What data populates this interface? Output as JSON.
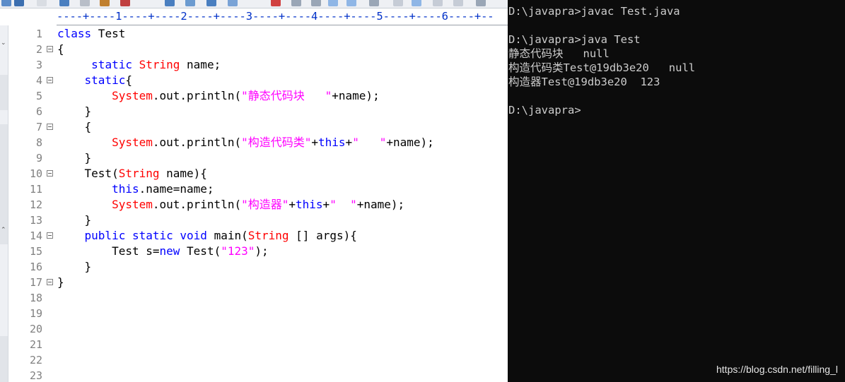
{
  "editor": {
    "ruler": "----+----1----+----2----+----3----+----4----+----5----+----6----+--",
    "lines": [
      {
        "num": "1",
        "fold": false,
        "tokens": [
          {
            "t": "class",
            "c": "kw"
          },
          {
            "t": " Test",
            "c": ""
          }
        ]
      },
      {
        "num": "2",
        "fold": true,
        "tokens": [
          {
            "t": "{",
            "c": ""
          }
        ]
      },
      {
        "num": "3",
        "fold": false,
        "tokens": [
          {
            "t": "     ",
            "c": ""
          },
          {
            "t": "static",
            "c": "kw"
          },
          {
            "t": " ",
            "c": ""
          },
          {
            "t": "String",
            "c": "type"
          },
          {
            "t": " name;",
            "c": ""
          }
        ]
      },
      {
        "num": "4",
        "fold": true,
        "tokens": [
          {
            "t": "    ",
            "c": ""
          },
          {
            "t": "static",
            "c": "kw"
          },
          {
            "t": "{",
            "c": ""
          }
        ]
      },
      {
        "num": "5",
        "fold": false,
        "tokens": [
          {
            "t": "        ",
            "c": ""
          },
          {
            "t": "System",
            "c": "type"
          },
          {
            "t": ".out.println(",
            "c": ""
          },
          {
            "t": "\"静态代码块   \"",
            "c": "str"
          },
          {
            "t": "+name);",
            "c": ""
          }
        ]
      },
      {
        "num": "6",
        "fold": false,
        "tokens": [
          {
            "t": "    }",
            "c": ""
          }
        ]
      },
      {
        "num": "7",
        "fold": true,
        "tokens": [
          {
            "t": "    {",
            "c": ""
          }
        ]
      },
      {
        "num": "8",
        "fold": false,
        "tokens": [
          {
            "t": "        ",
            "c": ""
          },
          {
            "t": "System",
            "c": "type"
          },
          {
            "t": ".out.println(",
            "c": ""
          },
          {
            "t": "\"构造代码类\"",
            "c": "str"
          },
          {
            "t": "+",
            "c": ""
          },
          {
            "t": "this",
            "c": "kw"
          },
          {
            "t": "+",
            "c": ""
          },
          {
            "t": "\"   \"",
            "c": "str"
          },
          {
            "t": "+name);",
            "c": ""
          }
        ]
      },
      {
        "num": "9",
        "fold": false,
        "tokens": [
          {
            "t": "    }",
            "c": ""
          }
        ]
      },
      {
        "num": "10",
        "fold": true,
        "tokens": [
          {
            "t": "    Test(",
            "c": ""
          },
          {
            "t": "String",
            "c": "type"
          },
          {
            "t": " name){",
            "c": ""
          }
        ]
      },
      {
        "num": "11",
        "fold": false,
        "tokens": [
          {
            "t": "        ",
            "c": ""
          },
          {
            "t": "this",
            "c": "kw"
          },
          {
            "t": ".name=name;",
            "c": ""
          }
        ]
      },
      {
        "num": "12",
        "fold": false,
        "tokens": [
          {
            "t": "        ",
            "c": ""
          },
          {
            "t": "System",
            "c": "type"
          },
          {
            "t": ".out.println(",
            "c": ""
          },
          {
            "t": "\"构造器\"",
            "c": "str"
          },
          {
            "t": "+",
            "c": ""
          },
          {
            "t": "this",
            "c": "kw"
          },
          {
            "t": "+",
            "c": ""
          },
          {
            "t": "\"  \"",
            "c": "str"
          },
          {
            "t": "+name);",
            "c": ""
          }
        ]
      },
      {
        "num": "13",
        "fold": false,
        "tokens": [
          {
            "t": "    }",
            "c": ""
          }
        ]
      },
      {
        "num": "14",
        "fold": true,
        "tokens": [
          {
            "t": "    ",
            "c": ""
          },
          {
            "t": "public",
            "c": "kw"
          },
          {
            "t": " ",
            "c": ""
          },
          {
            "t": "static",
            "c": "kw"
          },
          {
            "t": " ",
            "c": ""
          },
          {
            "t": "void",
            "c": "kw"
          },
          {
            "t": " main(",
            "c": ""
          },
          {
            "t": "String",
            "c": "type"
          },
          {
            "t": " [] args){",
            "c": ""
          }
        ]
      },
      {
        "num": "15",
        "fold": false,
        "tokens": [
          {
            "t": "        Test s=",
            "c": ""
          },
          {
            "t": "new",
            "c": "kw"
          },
          {
            "t": " Test(",
            "c": ""
          },
          {
            "t": "\"123\"",
            "c": "str"
          },
          {
            "t": ");",
            "c": ""
          }
        ]
      },
      {
        "num": "16",
        "fold": false,
        "tokens": [
          {
            "t": "    }",
            "c": ""
          }
        ]
      },
      {
        "num": "17",
        "fold": true,
        "tokens": [
          {
            "t": "}",
            "c": ""
          }
        ]
      },
      {
        "num": "18",
        "fold": false,
        "tokens": []
      },
      {
        "num": "19",
        "fold": false,
        "tokens": []
      },
      {
        "num": "20",
        "fold": false,
        "tokens": []
      },
      {
        "num": "21",
        "fold": false,
        "tokens": []
      },
      {
        "num": "22",
        "fold": false,
        "tokens": []
      },
      {
        "num": "23",
        "fold": false,
        "tokens": []
      }
    ]
  },
  "console": {
    "lines": [
      "D:\\javapra>javac Test.java",
      "",
      "D:\\javapra>java Test",
      "静态代码块   null",
      "构造代码类Test@19db3e20   null",
      "构造器Test@19db3e20  123",
      "",
      "D:\\javapra>"
    ],
    "watermark": "https://blog.csdn.net/filling_l"
  },
  "colors": {
    "keyword": "#0000ff",
    "type": "#ff0000",
    "string": "#ff00ff",
    "console_bg": "#0c0c0c",
    "console_text": "#cccccc"
  }
}
